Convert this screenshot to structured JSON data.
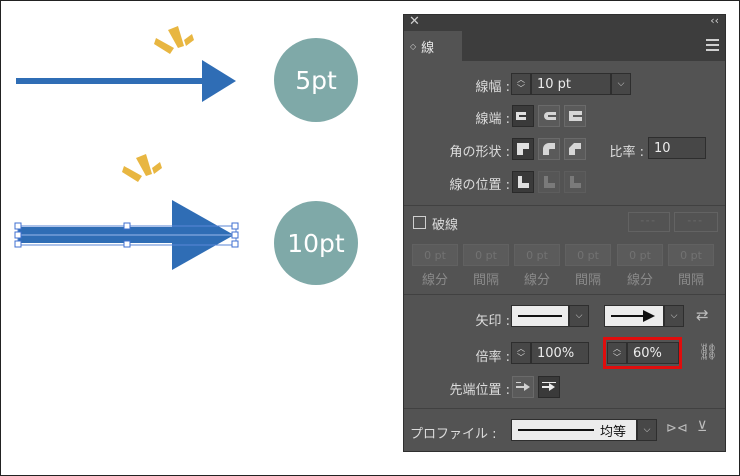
{
  "canvas": {
    "badge_top": "5pt",
    "badge_bottom": "10pt",
    "colors": {
      "arrow": "#2f6db5",
      "badge": "#7fa9a8",
      "spark": "#e8b641"
    }
  },
  "panel": {
    "tab_label": "線",
    "stroke_weight": {
      "label": "線幅 :",
      "value": "10 pt"
    },
    "cap": {
      "label": "線端 :"
    },
    "corner": {
      "label": "角の形状 :",
      "limit_label": "比率 :",
      "limit_value": "10"
    },
    "align": {
      "label": "線の位置 :"
    },
    "dashed": {
      "label": "破線",
      "cells": [
        "0 pt",
        "0 pt",
        "0 pt",
        "0 pt",
        "0 pt",
        "0 pt"
      ],
      "cell_labels": [
        "線分",
        "間隔",
        "線分",
        "間隔",
        "線分",
        "間隔"
      ]
    },
    "arrowheads": {
      "label": "矢印 :"
    },
    "scale": {
      "label": "倍率 :",
      "start_value": "100%",
      "end_value": "60%"
    },
    "align_arrow": {
      "label": "先端位置 :"
    },
    "profile": {
      "label": "プロファイル :",
      "value": "均等"
    }
  }
}
